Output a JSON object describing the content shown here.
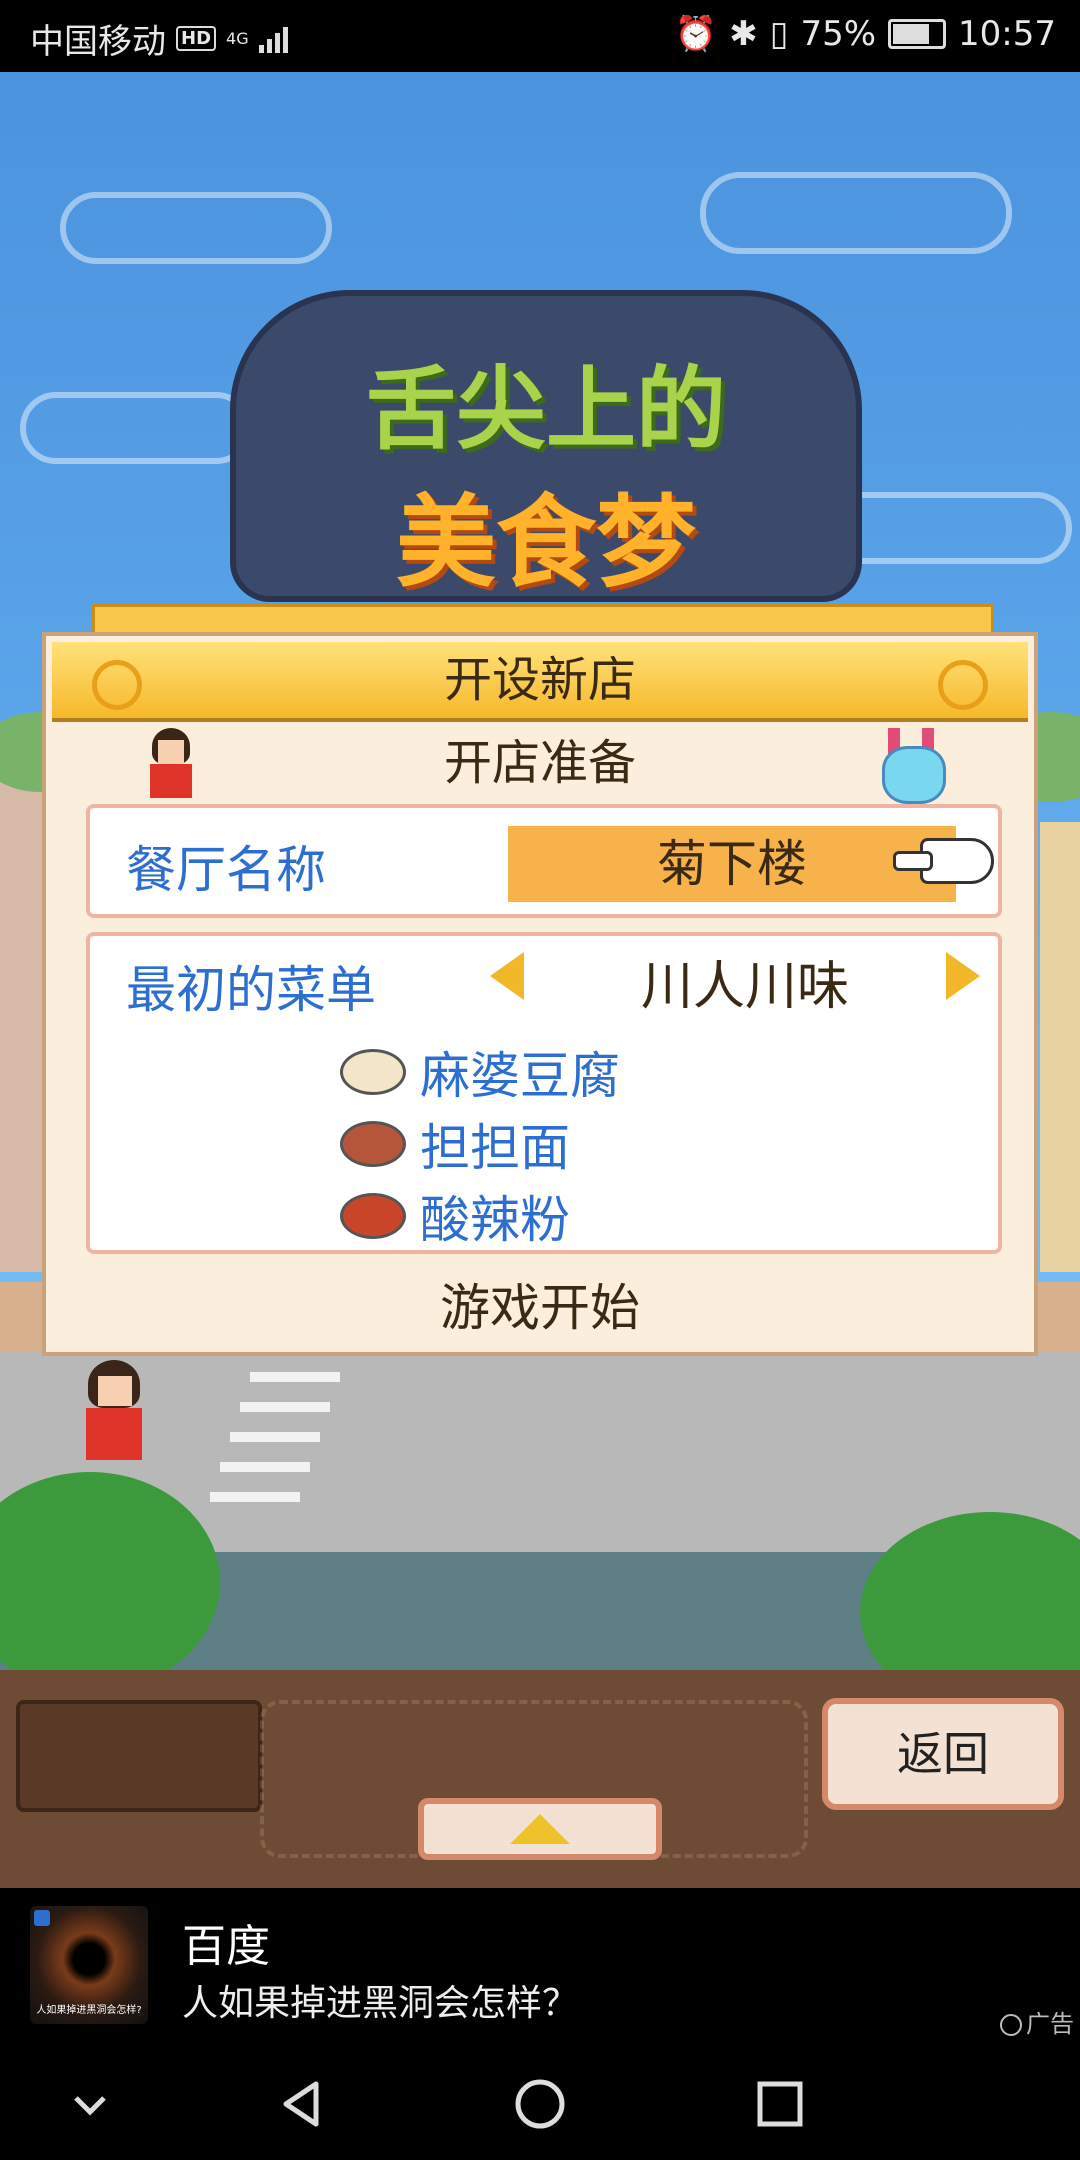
{
  "status_bar": {
    "carrier": "中国移动",
    "hd": "HD",
    "network": "4G",
    "battery": "75%",
    "time": "10:57"
  },
  "dialog": {
    "title": "开设新店",
    "subtitle": "开店准备",
    "restaurant_name_label": "餐厅名称",
    "restaurant_name_value": "菊下楼",
    "initial_menu_label": "最初的菜单",
    "initial_menu_value": "川人川味",
    "dishes": [
      "麻婆豆腐",
      "担担面",
      "酸辣粉"
    ],
    "start_label": "游戏开始"
  },
  "game_bar": {
    "back_label": "返回"
  },
  "ad": {
    "source": "百度",
    "text": "人如果掉进黑洞会怎样？",
    "thumb_text": "人如果掉进黑洞会怎样?",
    "tag": "广告"
  },
  "icons": {
    "nav_back": "back-triangle-icon",
    "nav_home": "home-circle-icon",
    "nav_recent": "recent-square-icon",
    "nav_collapse": "chevron-down-icon"
  }
}
